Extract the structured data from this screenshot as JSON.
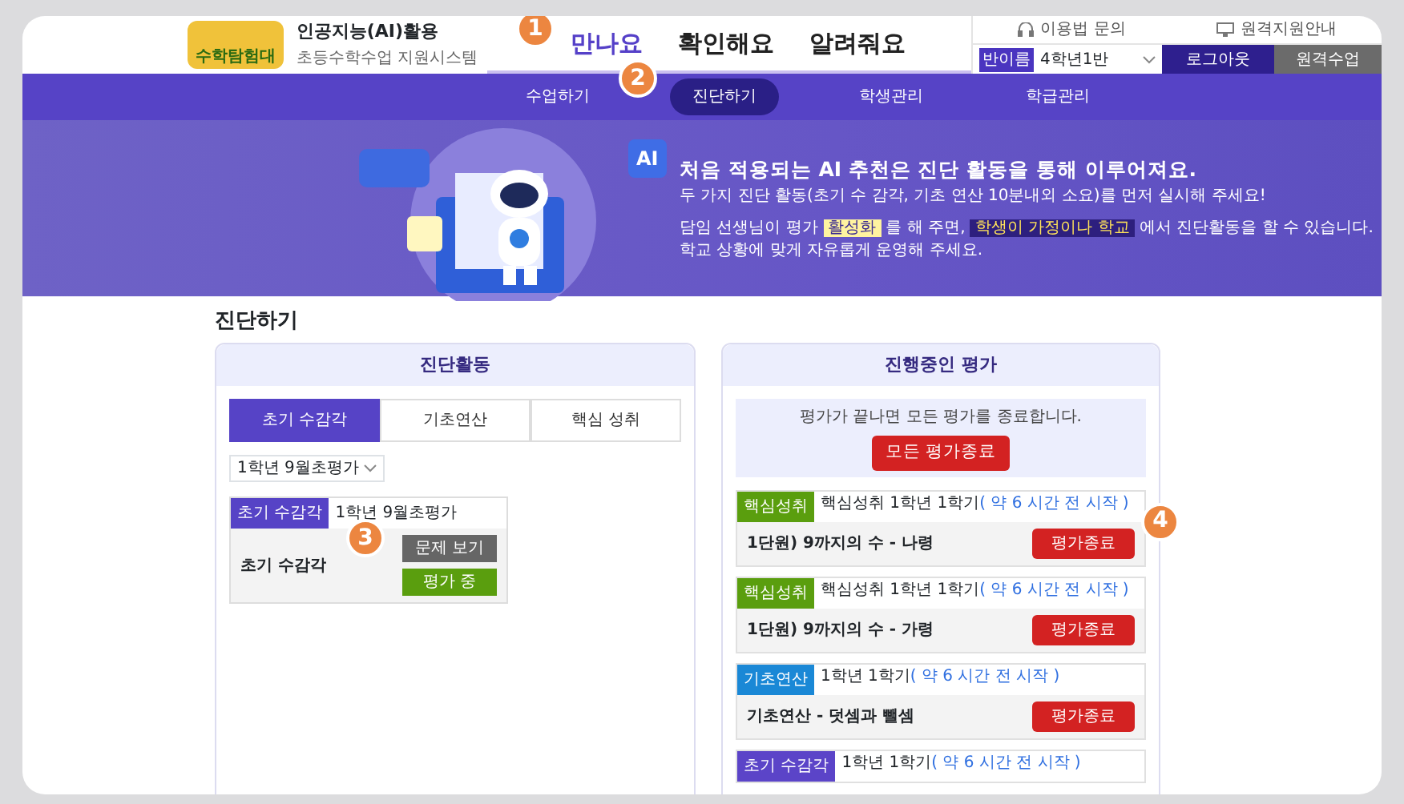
{
  "header": {
    "logo_text": "수학탐험대",
    "title": "인공지능(AI)활용",
    "subtitle": "초등수학수업 지원시스템",
    "main_menu": [
      {
        "label": "만나요",
        "selected": true
      },
      {
        "label": "확인해요",
        "selected": false
      },
      {
        "label": "알려줘요",
        "selected": false
      }
    ],
    "util_links": [
      {
        "kind": "help",
        "label": "이용법 문의"
      },
      {
        "kind": "remote",
        "label": "원격지원안내"
      }
    ],
    "class_select": {
      "badge": "반이름",
      "value": "4학년1반"
    },
    "logout": "로그아웃",
    "remote_class": "원격수업"
  },
  "sub_nav": [
    {
      "label": "수업하기",
      "selected": false
    },
    {
      "label": "진단하기",
      "selected": true
    },
    {
      "label": "학생관리",
      "selected": false
    },
    {
      "label": "학급관리",
      "selected": false
    }
  ],
  "hero": {
    "badge": "AI",
    "headline": "처음 적용되는 AI 추천은 진단 활동을 통해 이루어져요.",
    "subline": "두 가지 진단 활동(초기 수 감각, 기초 연산 10분내외 소요)를 먼저 실시해 주세요!",
    "body": [
      {
        "text": "담임 선생님이 평가",
        "kind": "plain"
      },
      {
        "text": "활성화",
        "kind": "yellow"
      },
      {
        "text": "를 해 주면,",
        "kind": "plain"
      },
      {
        "text": "학생이 가정이나 학교",
        "kind": "dark"
      },
      {
        "text": "에서 진단활동을 할 수 있습니다.",
        "kind": "plain"
      }
    ],
    "body_line2": "학교 상황에 맞게 자유롭게 운영해 주세요."
  },
  "section_title": "진단하기",
  "activity_panel": {
    "title": "진단활동",
    "tabs": [
      {
        "label": "초기 수감각",
        "selected": true
      },
      {
        "label": "기초연산",
        "selected": false
      },
      {
        "label": "핵심 성취",
        "selected": false
      }
    ],
    "filter": "1학년 9월초평가",
    "cards": [
      {
        "badge": "초기 수감각",
        "title": "1학년 9월초평가",
        "name": "초기 수감각",
        "buttons": [
          {
            "label": "문제 보기",
            "kind": "view"
          },
          {
            "label": "평가 중",
            "kind": "active"
          }
        ]
      }
    ]
  },
  "progress_panel": {
    "title": "진행중인 평가",
    "notice": "평가가 끝나면 모든 평가를 종료합니다.",
    "end_all": "모든 평가종료",
    "items": [
      {
        "badge": "핵심성취",
        "color": "#5a9e0e",
        "meta": "핵심성취 1학년 1학기",
        "time": "( 약 6 시간 전 시작 )",
        "name": "1단원) 9까지의 수 - 나령",
        "button": "평가종료"
      },
      {
        "badge": "핵심성취",
        "color": "#5a9e0e",
        "meta": "핵심성취 1학년 1학기",
        "time": "( 약 6 시간 전 시작 )",
        "name": "1단원) 9까지의 수 - 가령",
        "button": "평가종료"
      },
      {
        "badge": "기초연산",
        "color": "#1a88d6",
        "meta": "1학년 1학기",
        "time": "( 약 6 시간 전 시작 )",
        "name": "기초연산 - 덧셈과 뺄셈",
        "button": "평가종료"
      },
      {
        "badge": "초기 수감각",
        "color": "#5b44c8",
        "meta": "1학년 1학기",
        "time": "( 약 6 시간 전 시작 )"
      }
    ]
  },
  "markers": [
    "1",
    "2",
    "3",
    "4"
  ]
}
